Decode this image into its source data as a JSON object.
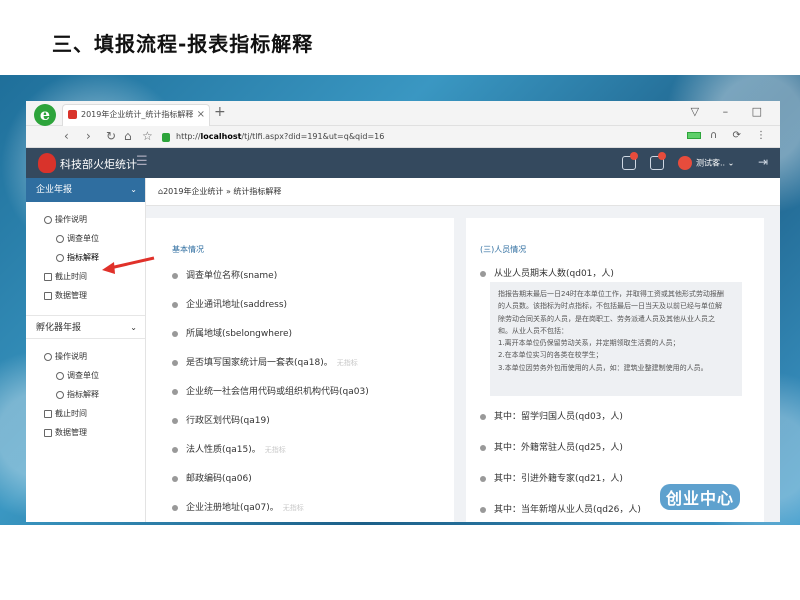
{
  "slide": {
    "title": "三、填报流程-报表指标解释"
  },
  "browser": {
    "tab_title": "2019年企业统计_统计指标解释",
    "tab_close": "×",
    "new_tab": "+",
    "url_prefix": "http://",
    "url_host": "localhost",
    "url_path": "/tj/tlfi.aspx?did=191&ut=q&qid=16",
    "nav_back": "‹",
    "nav_forward": "›",
    "nav_reload": "↻",
    "nav_home": "⌂",
    "nav_star": "☆",
    "window_controls": "▽ – □"
  },
  "app": {
    "name": "科技部火炬统计",
    "menu_icon": "☰",
    "user_name": "测试客.. ⌄",
    "logout_icon": "⇥"
  },
  "sidebar": {
    "group1": "企业年报",
    "group1_caret": "⌄",
    "g1_sub": "操作说明",
    "g1_item1": "调查单位",
    "g1_item2": "指标解释",
    "g1_item3": "截止时间",
    "g1_item4": "数据管理",
    "group2": "孵化器年报",
    "group2_caret": "⌄",
    "g2_sub": "操作说明",
    "g2_item1": "调查单位",
    "g2_item2": "指标解释",
    "g2_item3": "截止时间",
    "g2_item4": "数据管理"
  },
  "breadcrumb": "2019年企业统计 » 统计指标解释",
  "left_card": {
    "section": "基本情况",
    "fields": [
      {
        "label": "调查单位名称(sname)",
        "note": ""
      },
      {
        "label": "企业通讯地址(saddress)",
        "note": ""
      },
      {
        "label": "所属地域(sbelongwhere)",
        "note": ""
      },
      {
        "label": "是否填写国家统计局一套表(qa18)。",
        "note": "无指标"
      },
      {
        "label": "企业统一社会信用代码或组织机构代码(qa03)",
        "note": ""
      },
      {
        "label": "行政区划代码(qa19)",
        "note": ""
      },
      {
        "label": "法人性质(qa15)。",
        "note": "无指标"
      },
      {
        "label": "邮政编码(qa06)",
        "note": ""
      },
      {
        "label": "企业注册地址(qa07)。",
        "note": "无指标"
      }
    ]
  },
  "right_card": {
    "section": "(三)人员情况",
    "main_field": "从业人员期末人数(qd01，人)",
    "info_lines": [
      "指报告期末最后一日24时在本单位工作，并取得工资或其他形式劳动报酬",
      "的人员数。该指标为时点指标，不包括最后一日当天及以前已经与单位解",
      "除劳动合同关系的人员，是在岗职工、劳务派遣人员及其他从业人员之",
      "和。从业人员不包括：",
      "1.离开本单位仍保留劳动关系，并定期领取生活费的人员；",
      "2.在本单位实习的各类在校学生；",
      "3.本单位因劳务外包而使用的人员，如：建筑业整建制使用的人员。"
    ],
    "sub_fields": [
      "其中：留学归国人员(qd03，人)",
      "其中：外籍常驻人员(qd25，人)",
      "其中：引进外籍专家(qd21，人)",
      "其中：当年新增从业人员(qd26，人)"
    ]
  },
  "watermark": "创业中心",
  "colors": {
    "accent": "#2f6ea0",
    "header": "#34495e",
    "arrow": "#e0312a"
  }
}
